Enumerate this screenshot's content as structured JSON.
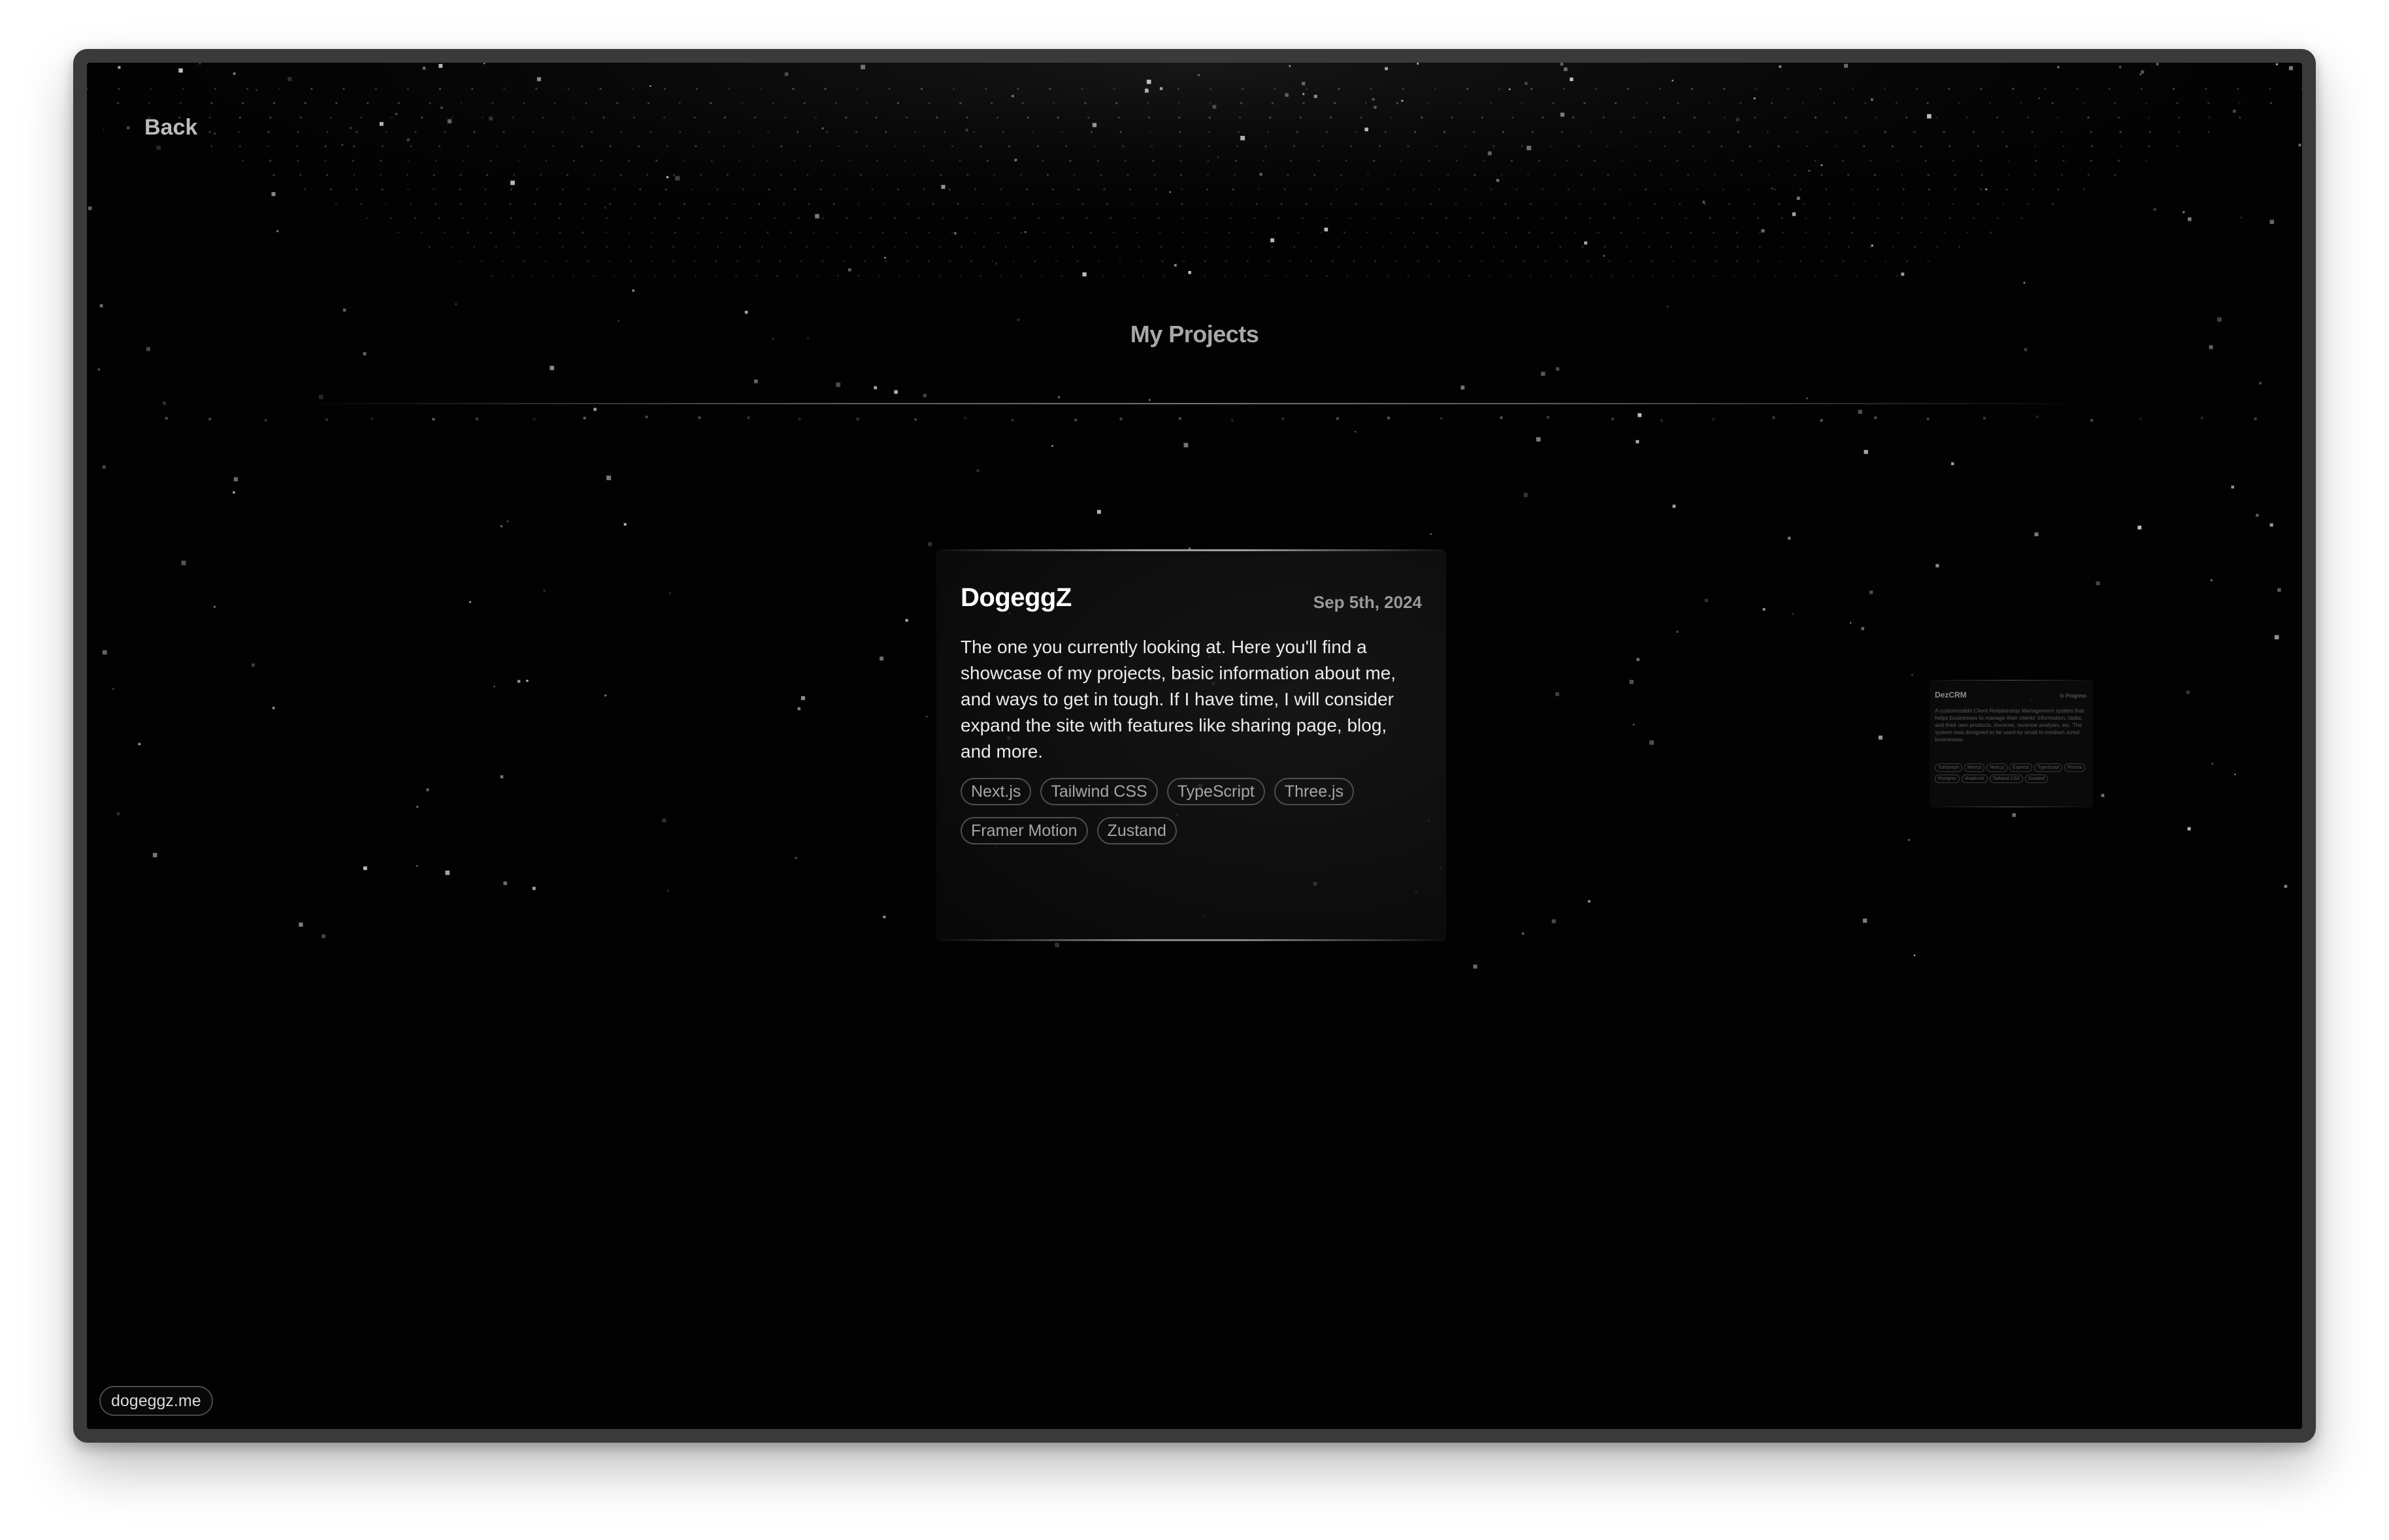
{
  "nav": {
    "back_label": "Back"
  },
  "page": {
    "title": "My Projects"
  },
  "featured_project": {
    "name": "DogeggZ",
    "date": "Sep 5th, 2024",
    "description": "The one you currently looking at. Here you'll find a showcase of my projects, basic information about me, and ways to get in tough. If I have time, I will consider expand the site with features like sharing page, blog, and more.",
    "tags": [
      "Next.js",
      "Tailwind CSS",
      "TypeScript",
      "Three.js",
      "Framer Motion",
      "Zustand"
    ]
  },
  "side_project": {
    "name": "DezCRM",
    "status": "In Progress",
    "description": "A customizable Client Relationship Management system that helps businesses to manage their clients' information, tasks, and their own products, invoices, revenue analysis, etc. The system was designed to be used by small to medium sized businesses.",
    "tags": [
      "Turborepo",
      "Next.js",
      "Nest.js",
      "Express",
      "TypeScript",
      "Prisma",
      "Postgres",
      "shadcn/ui",
      "Tailwind CSS",
      "Zustand"
    ]
  },
  "footer": {
    "domain_label": "dogeggz.me"
  },
  "colors": {
    "background": "#020202",
    "frame": "#3a3a3a",
    "text_primary": "#ffffff",
    "text_muted": "#9a9a9a"
  }
}
